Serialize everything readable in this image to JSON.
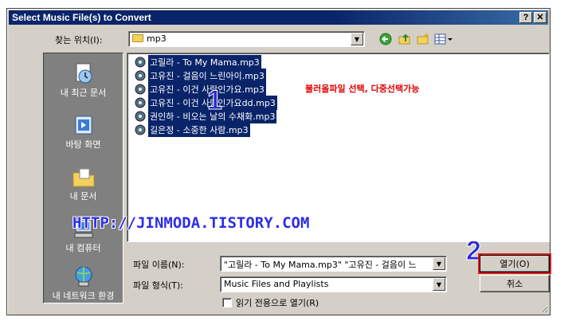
{
  "window": {
    "title": "Select Music File(s) to Convert",
    "help_label": "?",
    "close_label": "✕"
  },
  "lookin": {
    "label": "찾는 위치(I):",
    "value": "mp3"
  },
  "toolbar": {
    "back_icon": "back-arrow-icon",
    "up_icon": "up-folder-icon",
    "newfolder_icon": "new-folder-icon",
    "views_icon": "views-menu-icon"
  },
  "places": [
    {
      "label": "내 최근 문서",
      "icon": "recent-documents-icon"
    },
    {
      "label": "바탕 화면",
      "icon": "desktop-icon"
    },
    {
      "label": "내 문서",
      "icon": "my-documents-icon"
    },
    {
      "label": "내 컴퓨터",
      "icon": "my-computer-icon"
    },
    {
      "label": "내 네트워크 환경",
      "icon": "network-icon"
    }
  ],
  "files": [
    "고릴라 - To My Mama.mp3",
    "고유진 - 걸음이 느린아이.mp3",
    "고유진 - 이건 사랑인가요.mp3",
    "고유진 - 이건 사랑인가요dd.mp3",
    "권인하 - 비오는 날의 수채화.mp3",
    "길은정 - 소중한 사람.mp3"
  ],
  "annotations": {
    "note": "불러올파일 선택, 다중선택가능",
    "step1": "1",
    "step2": "2",
    "watermark": "HTTP://JINMODA.TISTORY.COM"
  },
  "filename": {
    "label": "파일 이름(N):",
    "value": "\"고릴라 - To My Mama.mp3\" \"고유진 - 걸음이 느"
  },
  "filetype": {
    "label": "파일 형식(T):",
    "value": "Music Files and Playlists"
  },
  "readonly": {
    "label": "읽기 전용으로 열기(R)",
    "checked": false
  },
  "buttons": {
    "open": "열기(O)",
    "cancel": "취소"
  },
  "colors": {
    "title_bar": "#0a246a",
    "selection": "#0a246a",
    "note": "#e00000",
    "annotation": "#2a2ad4",
    "highlight_box": "#e02020"
  }
}
